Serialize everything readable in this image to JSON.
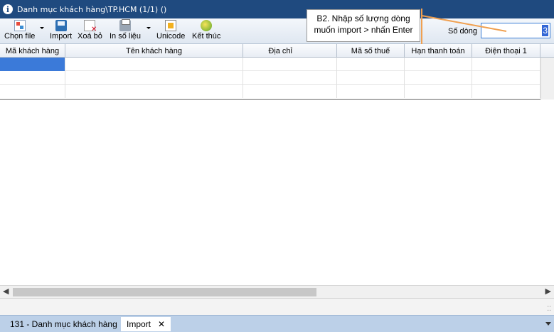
{
  "window": {
    "title": "Danh mục khách hàng\\TP.HCM (1/1) ()"
  },
  "toolbar": {
    "chon_file": "Chọn file",
    "import": "Import",
    "xoa_bo": "Xoá bỏ",
    "in_so_lieu": "In số liệu",
    "unicode": "Unicode",
    "ket_thuc": "Kết thúc",
    "so_dong_label": "Số dòng",
    "so_dong_value": "3"
  },
  "callout": {
    "line1": "B2. Nhập số lượng dòng",
    "line2": "muốn import > nhấn Enter"
  },
  "grid": {
    "columns": [
      "Mã khách hàng",
      "Tên khách hàng",
      "Địa chỉ",
      "Mã số thuế",
      "Hạn thanh toán",
      "Điện thoại 1"
    ]
  },
  "tabs": [
    {
      "label": "131 - Danh mục khách hàng"
    },
    {
      "label": "Import"
    }
  ],
  "colors": {
    "titlebar": "#1f4a7f",
    "selection": "#3b7ad9",
    "callout_line": "#f0a050",
    "tabbar": "#bcd0e8"
  }
}
